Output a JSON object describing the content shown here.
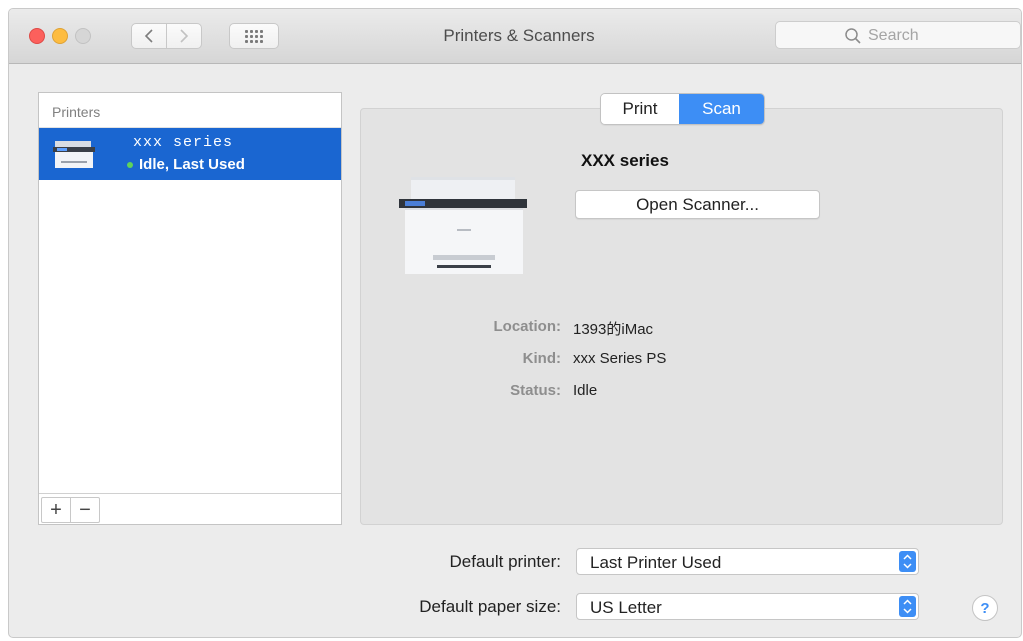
{
  "window": {
    "title": "Printers & Scanners"
  },
  "toolbar": {
    "back_icon": "chevron-left-icon",
    "forward_icon": "chevron-right-icon",
    "grid_icon": "show-all-grid-icon"
  },
  "search": {
    "placeholder": "Search"
  },
  "printers_list": {
    "header": "Printers",
    "items": [
      {
        "name": "xxx series",
        "status": "Idle, Last Used",
        "selected": true,
        "status_color": "#5fd35a"
      }
    ],
    "add_label": "+",
    "remove_label": "−"
  },
  "tabs": [
    {
      "label": "Print",
      "selected": false
    },
    {
      "label": "Scan",
      "selected": true
    }
  ],
  "details": {
    "printer_name": "XXX series",
    "open_scanner_label": "Open Scanner...",
    "info": [
      {
        "label": "Location:",
        "value": "1393的iMac"
      },
      {
        "label": "Kind:",
        "value": "xxx Series PS"
      },
      {
        "label": "Status:",
        "value": "Idle"
      }
    ]
  },
  "defaults": {
    "printer_label": "Default printer:",
    "printer_value": "Last Printer Used",
    "paper_label": "Default paper size:",
    "paper_value": "US Letter"
  },
  "help_label": "?",
  "colors": {
    "accent": "#3d8ef5",
    "selection": "#1a66d1"
  }
}
